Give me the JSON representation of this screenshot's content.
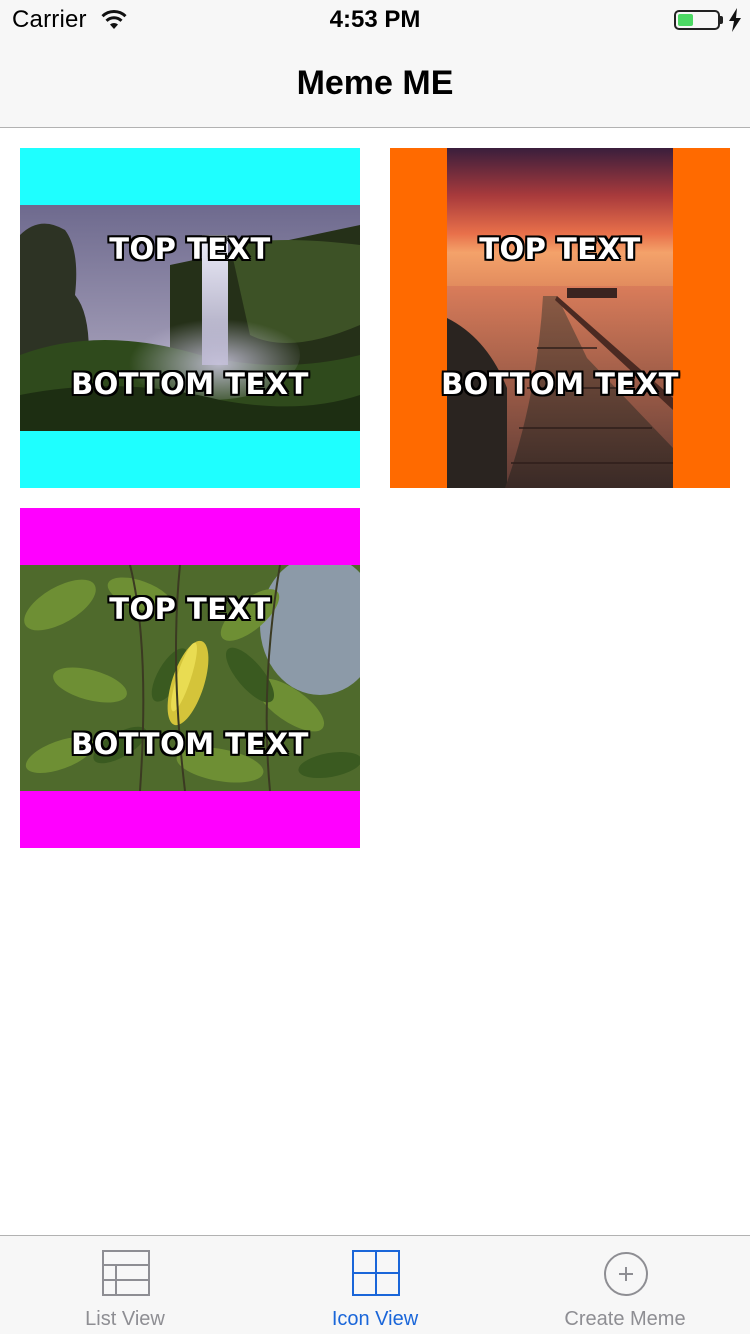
{
  "status_bar": {
    "carrier": "Carrier",
    "time": "4:53 PM",
    "battery_level_percent": 40,
    "battery_color": "#4cd964",
    "icons": [
      "wifi-icon",
      "battery-icon",
      "charging-bolt-icon"
    ]
  },
  "nav": {
    "title": "Meme ME"
  },
  "memes": [
    {
      "top_text": "TOP TEXT",
      "bottom_text": "BOTTOM TEXT",
      "background_color": "#1effff",
      "image": "waterfall-photo"
    },
    {
      "top_text": "TOP TEXT",
      "bottom_text": "BOTTOM TEXT",
      "background_color": "#ff6a00",
      "image": "sunset-boardwalk-photo"
    },
    {
      "top_text": "TOP TEXT",
      "bottom_text": "BOTTOM TEXT",
      "background_color": "#ff00ff",
      "image": "green-leaves-photo"
    }
  ],
  "tabs": [
    {
      "label": "List View",
      "icon": "list-icon",
      "active": false
    },
    {
      "label": "Icon View",
      "icon": "grid-icon",
      "active": true
    },
    {
      "label": "Create Meme",
      "icon": "plus-circle-icon",
      "active": false
    }
  ],
  "colors": {
    "tab_active": "#1a66d9",
    "tab_inactive": "#8e8e93",
    "bar_background": "#f7f7f7"
  }
}
